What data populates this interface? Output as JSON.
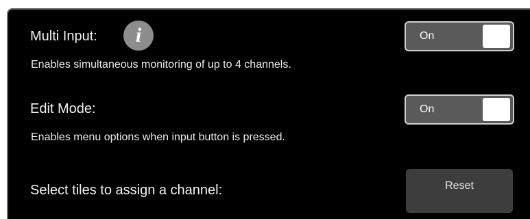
{
  "multi_input": {
    "title": "Multi Input:",
    "info_glyph": "i",
    "description": "Enables simultaneous monitoring of up to 4 channels.",
    "toggle_label": "On",
    "toggle_state": true
  },
  "edit_mode": {
    "title": "Edit Mode:",
    "description": "Enables menu options when input button is pressed.",
    "toggle_label": "On",
    "toggle_state": true
  },
  "tiles": {
    "title": "Select tiles to assign a channel:",
    "reset_label": "Reset"
  },
  "icons": {
    "info": "info-icon"
  },
  "colors": {
    "background": "#000000",
    "toggle_bg": "#5a5a5a",
    "toggle_knob": "#ffffff",
    "button_bg": "#3d3d3d",
    "info_icon_bg": "#8d8d8d"
  }
}
